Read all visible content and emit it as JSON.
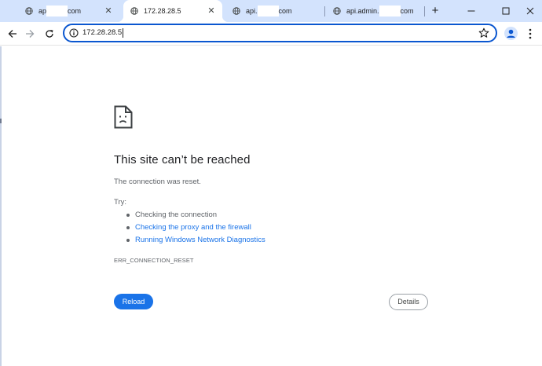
{
  "tabs": [
    {
      "label_prefix": "ap",
      "label_suffix": "com",
      "active": false
    },
    {
      "label_prefix": "172.28.28.5",
      "label_suffix": "",
      "active": true
    },
    {
      "label_prefix": "api.",
      "label_suffix": "com",
      "active": false
    },
    {
      "label_prefix": "api.admin.",
      "label_suffix": "com",
      "active": false
    }
  ],
  "toolbar": {
    "url": "172.28.28.5"
  },
  "error": {
    "title": "This site can’t be reached",
    "message": "The connection was reset.",
    "try_label": "Try:",
    "suggestions": [
      {
        "text": "Checking the connection",
        "link": false
      },
      {
        "text": "Checking the proxy and the firewall",
        "link": true
      },
      {
        "text": "Running Windows Network Diagnostics",
        "link": true
      }
    ],
    "code": "ERR_CONNECTION_RESET",
    "reload_label": "Reload",
    "details_label": "Details"
  },
  "colors": {
    "tabstrip": "#d3e3fd",
    "accent": "#1a73e8",
    "omnibox_border": "#0b57d0"
  },
  "icons": [
    "globe-icon",
    "close-icon",
    "plus-icon",
    "minimize-icon",
    "maximize-icon",
    "back-icon",
    "forward-icon",
    "reload-icon",
    "info-icon",
    "star-icon",
    "profile-icon",
    "kebab-menu-icon",
    "sad-page-icon"
  ]
}
